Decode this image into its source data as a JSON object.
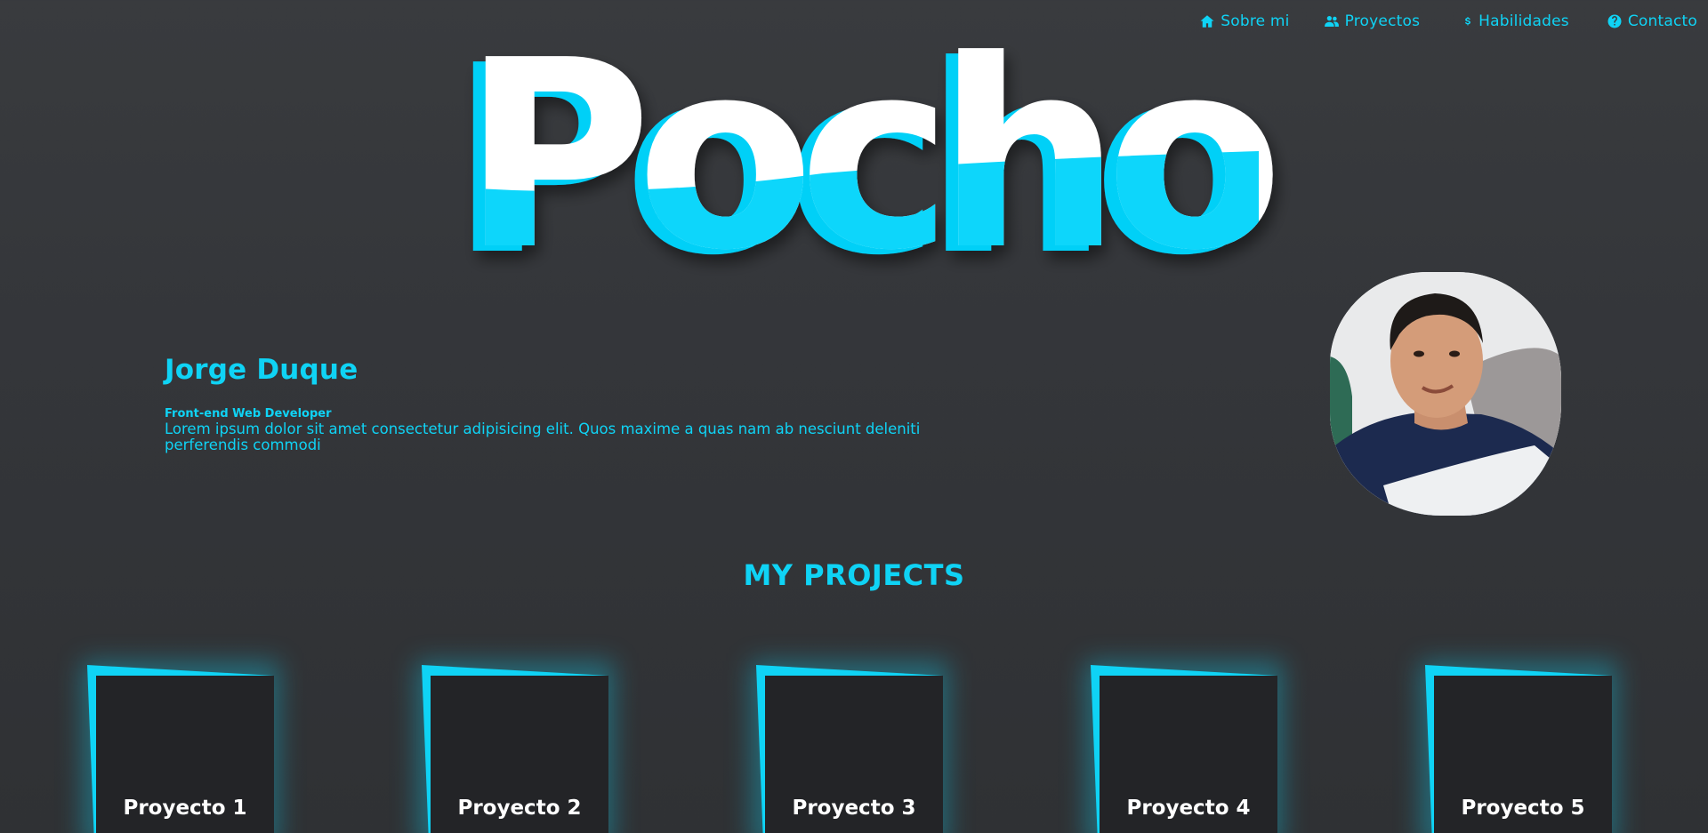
{
  "nav": {
    "items": [
      {
        "label": "Sobre mi",
        "icon": "home-icon"
      },
      {
        "label": "Proyectos",
        "icon": "users-icon"
      },
      {
        "label": "Habilidades",
        "icon": "dollar-icon"
      },
      {
        "label": "Contacto",
        "icon": "question-circle-icon"
      }
    ]
  },
  "hero": {
    "logo_text": "Pocho"
  },
  "about": {
    "name": "Jorge Duque",
    "role": "Front-end Web Developer",
    "description": "Lorem ipsum dolor sit amet consectetur adipisicing elit. Quos maxime a quas nam ab nesciunt deleniti perferendis commodi"
  },
  "projects": {
    "title": "MY PROJECTS",
    "items": [
      {
        "label": "Proyecto 1"
      },
      {
        "label": "Proyecto 2"
      },
      {
        "label": "Proyecto 3"
      },
      {
        "label": "Proyecto 4"
      },
      {
        "label": "Proyecto 5"
      }
    ]
  },
  "colors": {
    "accent": "#0fd3f5",
    "background": "#35373a",
    "card": "#232427",
    "card_text": "#ffffff"
  }
}
